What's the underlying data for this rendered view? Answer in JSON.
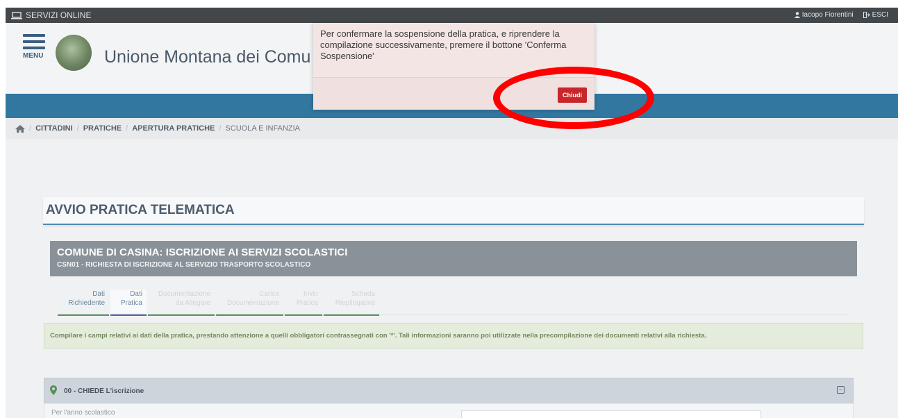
{
  "topbar": {
    "service_label": "SERVIZI ONLINE",
    "user_name": "Iacopo Fiorentini",
    "logout_label": "ESCI"
  },
  "header": {
    "menu_label": "MENU",
    "brand_text": "Unione Montana dei Comu"
  },
  "breadcrumb": {
    "items": [
      "CITTADINI",
      "PRATICHE",
      "APERTURA PRATICHE"
    ],
    "current": "SCUOLA E INFANZIA"
  },
  "page": {
    "title": "AVVIO PRATICA TELEMATICA"
  },
  "comune": {
    "title": "COMUNE DI CASINA: ISCRIZIONE AI SERVIZI SCOLASTICI",
    "subtitle": "CSN01 - RICHIESTA DI ISCRIZIONE AL SERVIZIO TRASPORTO SCOLASTICO"
  },
  "steps": [
    {
      "line1": "Dati",
      "line2": "Richiedente"
    },
    {
      "line1": "Dati",
      "line2": "Pratica"
    },
    {
      "line1": "Documentazione",
      "line2": "da Allegare"
    },
    {
      "line1": "Carica",
      "line2": "Documentazione"
    },
    {
      "line1": "Invio",
      "line2": "Pratica"
    },
    {
      "line1": "Scheda",
      "line2": "Riepilogativa"
    }
  ],
  "note_text": "Compilare i campi relativi ai dati della pratica, prestando attenzione a quelli obbligatori contrassegnati con '*'. Tali informazioni saranno poi utilizzate nella precompilazione dei documenti relativi alla richiesta.",
  "section": {
    "title": "00 - CHIEDE L'iscrizione",
    "field_label": "Per l'anno scolastico",
    "collapse_symbol": "−"
  },
  "modal": {
    "message": "Per confermare la sospensione della pratica, e riprendere la compilazione successivamente, premere il bottone 'Conferma Sospensione'",
    "close_label": "Chiudi"
  },
  "colors": {
    "accent_blue": "#06598c",
    "modal_button": "#c8262a",
    "highlight_ring": "#ff0000"
  }
}
